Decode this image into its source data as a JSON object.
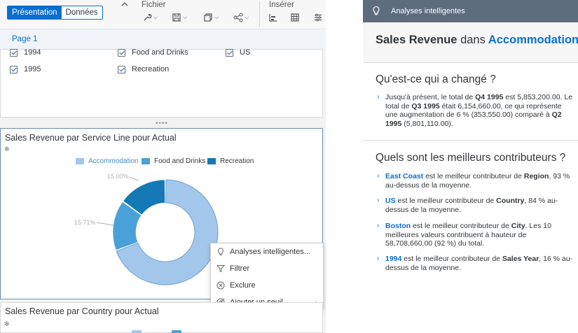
{
  "toolbar": {
    "view_tabs": [
      "Présentation",
      "Données"
    ],
    "file_label": "Fichier",
    "insert_label": "Insérer",
    "icons": [
      "collapse-icon",
      "tools-icon",
      "save-icon",
      "copy-icon",
      "share-icon",
      "bar-chart-icon",
      "table-icon",
      "filter-settings-icon"
    ]
  },
  "page": {
    "tab": "Page 1"
  },
  "filter_card": {
    "col1": [
      "1994",
      "1995"
    ],
    "col2": [
      "Food and Drinks",
      "Recreation"
    ],
    "col3": [
      "US"
    ]
  },
  "chart1": {
    "title": "Sales Revenue par Service Line pour Actual",
    "legend": [
      "Accommodation",
      "Food and Drinks",
      "Recreation"
    ],
    "labels": [
      "15.00%",
      "15.71%"
    ]
  },
  "context_menu": {
    "items": [
      {
        "label": "Analyses intelligentes...",
        "icon": "lightbulb-icon"
      },
      {
        "label": "Filtrer",
        "icon": "filter-icon"
      },
      {
        "label": "Exclure",
        "icon": "exclude-icon"
      },
      {
        "label": "Ajouter un seuil",
        "icon": "threshold-icon"
      }
    ]
  },
  "chart2": {
    "title": "Sales Revenue par Country pour Actual"
  },
  "insights": {
    "header": "Analyses intelligentes",
    "title_metric": "Sales Revenue",
    "title_dans": "dans",
    "title_member": "Accommodation",
    "section1": "Qu'est-ce qui a changé ?",
    "section2": "Quels sont les meilleurs contributeurs ?"
  },
  "colors": {
    "accommodation": "#a3c7ea",
    "food_and_drinks": "#4aa1d8",
    "recreation": "#1479b4",
    "accent": "#0a6ed1"
  },
  "chart_data": {
    "type": "pie",
    "title": "Sales Revenue par Service Line pour Actual",
    "categories": [
      "Accommodation",
      "Food and Drinks",
      "Recreation"
    ],
    "values": [
      69.29,
      15.71,
      15.0
    ],
    "unit": "%"
  }
}
